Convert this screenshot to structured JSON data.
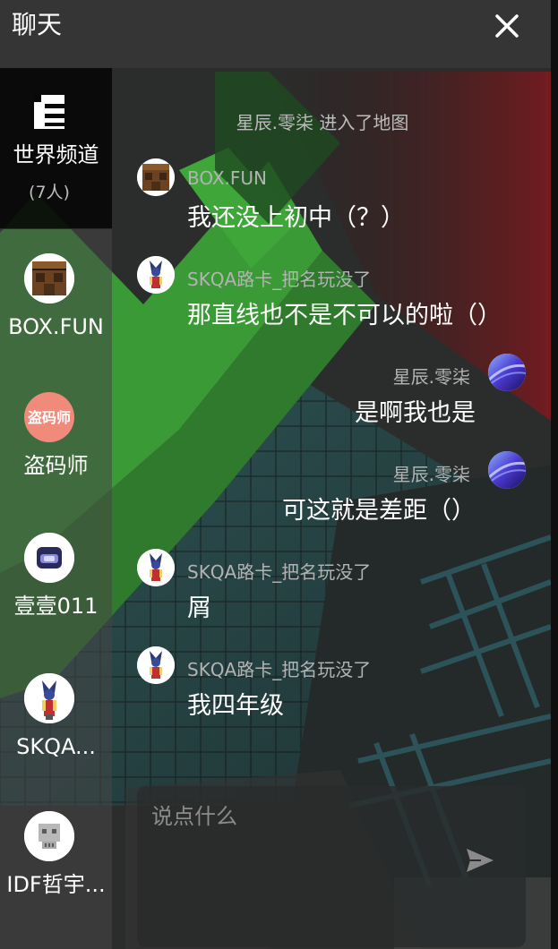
{
  "header": {
    "title": "聊天",
    "close_icon": "close-icon"
  },
  "sidebar": {
    "world_channel": {
      "label": "世界频道",
      "count": "(7人)",
      "icon": "channel-icon"
    },
    "items": [
      {
        "label": "BOX.FUN",
        "avatar": "crafting-table-avatar"
      },
      {
        "label": "盗码师",
        "avatar": "daomashi-logo-avatar",
        "avatar_text": "盗码师"
      },
      {
        "label": "壹壹011",
        "avatar": "chest-avatar"
      },
      {
        "label": "SKQA...",
        "avatar": "pokemon-avatar"
      },
      {
        "label": "IDF哲宇...",
        "avatar": "skull-avatar"
      }
    ]
  },
  "chat": {
    "system_message": "星辰.零柒 进入了地图",
    "messages": [
      {
        "side": "left",
        "name": "BOX.FUN",
        "text": "我还没上初中（？）",
        "avatar": "crafting-table-avatar"
      },
      {
        "side": "left",
        "name": "SKQA路卡_把名玩没了",
        "text": "那直线也不是不可以的啦（）",
        "avatar": "pokemon-avatar"
      },
      {
        "side": "right",
        "name": "星辰.零柒",
        "text": "是啊我也是",
        "avatar": "galaxy-avatar"
      },
      {
        "side": "right",
        "name": "星辰.零柒",
        "text": "可这就是差距（）",
        "avatar": "galaxy-avatar"
      },
      {
        "side": "left",
        "name": "SKQA路卡_把名玩没了",
        "text": "屑",
        "avatar": "pokemon-avatar"
      },
      {
        "side": "left",
        "name": "SKQA路卡_把名玩没了",
        "text": "我四年级",
        "avatar": "pokemon-avatar"
      }
    ]
  },
  "input": {
    "placeholder": "说点什么",
    "value": "",
    "send_icon": "send-icon"
  },
  "colors": {
    "header_bg": "#363636",
    "sidebar_active_bg": "#0a0a0a",
    "text": "#ffffff",
    "name_text": "#b3b3b3",
    "accent_green": "#3aa33a"
  }
}
